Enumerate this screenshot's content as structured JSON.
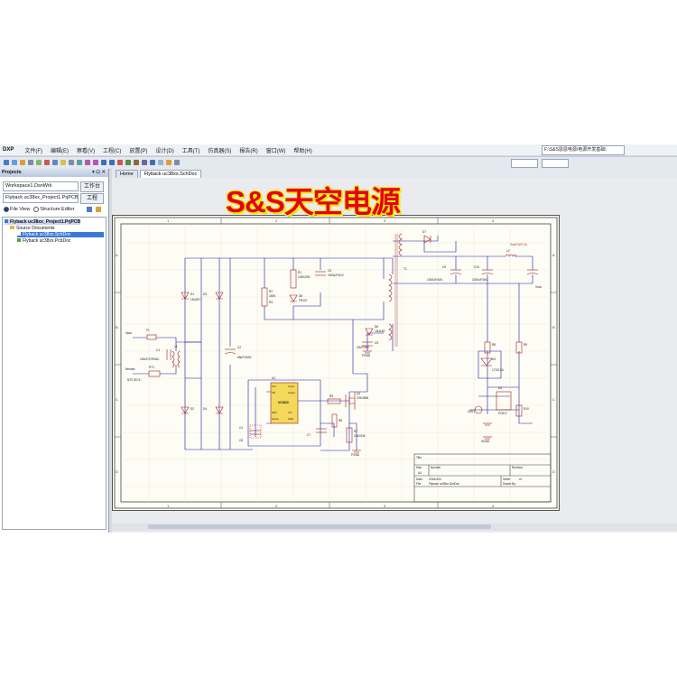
{
  "menu": {
    "dxp": "DXP",
    "items": [
      "文件(F)",
      "编辑(E)",
      "察看(V)",
      "工程(C)",
      "放置(P)",
      "设计(D)",
      "工具(T)",
      "仿真器(S)",
      "报告(R)",
      "窗口(W)",
      "帮助(H)"
    ],
    "path": "F:\\S&S恩恩电源\\电源开发基础\\"
  },
  "projects_panel": {
    "title": "Projects",
    "workspace": "Workspace1.DsnWrk",
    "workspace_button": "工作台",
    "project": "Flyback uc38xx_Project1.PrjPCB",
    "project_button": "工程",
    "file_view": "File View",
    "structure_editor": "Structure Editor",
    "tree": {
      "project": "Flyback uc38xx_Project1.PrjPCB",
      "folder": "Source Documents",
      "files": [
        "Flyback uc38xx.SchDoc",
        "Flyback uc38xx.PcbDoc"
      ]
    }
  },
  "tabs": [
    "Home",
    "Flyback uc38xx.SchDoc"
  ],
  "overlay_title": "S&S天空电源",
  "sheet": {
    "col_labels": [
      "1",
      "2",
      "3",
      "4"
    ],
    "row_labels": [
      "A",
      "B",
      "C",
      "D"
    ],
    "title_block": {
      "title": "Title",
      "size_label": "Size",
      "size": "A4",
      "number_label": "Number",
      "revision_label": "Revision",
      "date_label": "Date:",
      "date": "2016/4/21",
      "file_label": "File:",
      "file": "Flyback uc38xx.SchDoc",
      "sheet_label": "Sheet",
      "sheet_of": "of",
      "drawn_by": "Drawn By:"
    },
    "components": {
      "F1": "F1",
      "C1": "C1",
      "C1_val": "100nF/275VAC",
      "L1": "L1",
      "RT1": "RT1",
      "RT1_val": "NTC 5D-9",
      "input": "Input",
      "neutral": "Neutral",
      "D1": "D1",
      "D2": "D2",
      "D3": "D3",
      "D4": "D4",
      "D1_val": "1N4007",
      "C2": "C2",
      "C2_val": "68uF/400V",
      "R2": "R2",
      "R2_val": "150K",
      "R3": "R3",
      "R3_val": "150K",
      "R1": "R1",
      "R1_val": "100K/2W",
      "C3": "C3",
      "C3_val": "1000pF/1KV",
      "D5": "D5",
      "D5_val": "FR107",
      "T1": "T1",
      "D6": "D6",
      "D6_val": "1N4148",
      "C5": "C5",
      "C5_val": "22uF/25V",
      "U1": "U1",
      "U1_name": "UC3843",
      "U1_pins": [
        "Vref",
        "Vfb",
        "Isense",
        "Rt/Ct",
        "Output",
        "Vcc",
        "GND",
        "Comp"
      ],
      "Q1": "Q1",
      "Q1_val": "2SK3565",
      "R5": "R5",
      "R6": "R6",
      "R7": "R7",
      "R7_val": "0.5Ω/1W",
      "C4": "C4",
      "C7": "C7",
      "C8": "C8",
      "D7": "D7",
      "L2": "L2",
      "C9": "C9",
      "C10": "C10",
      "C9_val": "1000uF/16V",
      "C10_val": "1000uF/16V",
      "vout": "Vout+12V 1A",
      "vout_minus": "Vout-",
      "U3": "U3",
      "U3_name": "LT1017A",
      "R8": "R8",
      "R9": "R9",
      "R10": "R10",
      "LED1": "LED1",
      "U4": "U4",
      "U4_name": "PC817",
      "gnd": "PGND",
      "sgnd": "SGND"
    }
  },
  "colors": {
    "accent": "#e4001b",
    "outline": "#f5e600",
    "wire": "#1a1aa8",
    "part": "#a51b1b"
  }
}
